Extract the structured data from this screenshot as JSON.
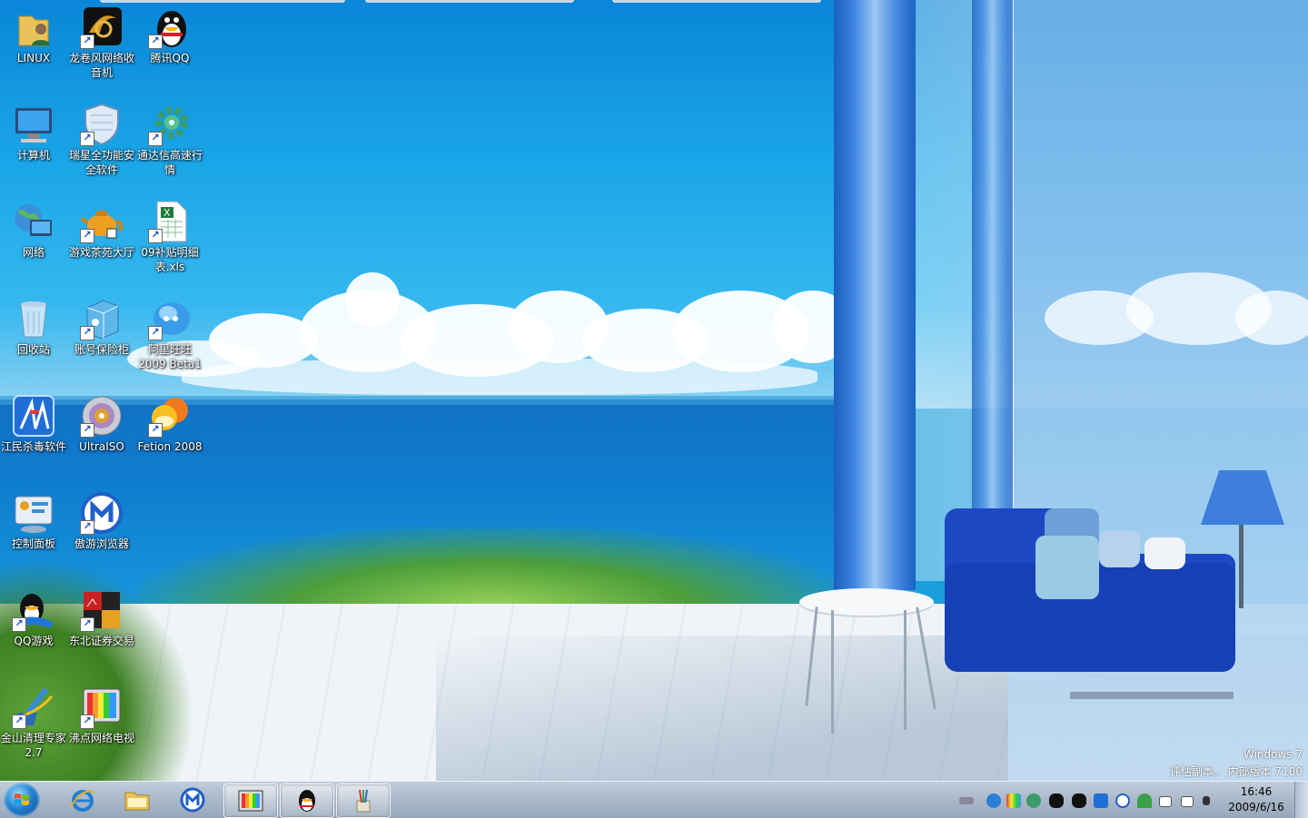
{
  "desktop": {
    "icons": [
      {
        "label": "LINUX",
        "icon": "folder-user-icon"
      },
      {
        "label": "龙卷风网络收音机",
        "icon": "radio-app-icon"
      },
      {
        "label": "腾讯QQ",
        "icon": "qq-penguin-icon"
      },
      {
        "label": "计算机",
        "icon": "computer-icon"
      },
      {
        "label": "瑞星全功能安全软件",
        "icon": "rising-shield-icon"
      },
      {
        "label": "通达信高速行情",
        "icon": "gear-icon"
      },
      {
        "label": "网络",
        "icon": "network-globe-icon"
      },
      {
        "label": "游戏茶苑大厅",
        "icon": "teapot-icon"
      },
      {
        "label": "09补贴明细表.xls",
        "icon": "excel-file-icon"
      },
      {
        "label": "回收站",
        "icon": "recycle-bin-icon"
      },
      {
        "label": "账号保险柜",
        "icon": "safe-box-icon"
      },
      {
        "label": "阿里旺旺2009 Beta1",
        "icon": "aliwangwang-icon"
      },
      {
        "label": "江民杀毒软件",
        "icon": "jiangmin-antivirus-icon"
      },
      {
        "label": "UltraISO",
        "icon": "disc-icon"
      },
      {
        "label": "Fetion 2008",
        "icon": "fetion-icon"
      },
      {
        "label": "控制面板",
        "icon": "control-panel-icon"
      },
      {
        "label": "傲游浏览器",
        "icon": "maxthon-icon"
      },
      {
        "label": "QQ游戏",
        "icon": "qq-game-icon"
      },
      {
        "label": "东北证券交易",
        "icon": "stock-trade-icon"
      },
      {
        "label": "金山清理专家 2.7",
        "icon": "broom-cleaner-icon"
      },
      {
        "label": "沸点网络电视",
        "icon": "tv-icon"
      }
    ]
  },
  "watermark": {
    "line1": "Windows 7",
    "line2": "评估副本。 内部版本 7100"
  },
  "taskbar": {
    "pinned": [
      {
        "name": "ie-browser",
        "icon": "ie-icon"
      },
      {
        "name": "explorer",
        "icon": "folder-icon"
      },
      {
        "name": "maxthon",
        "icon": "maxthon-icon"
      },
      {
        "name": "tv",
        "icon": "tv-icon"
      },
      {
        "name": "qq",
        "icon": "qq-penguin-icon"
      },
      {
        "name": "paint",
        "icon": "paint-brushes-icon"
      }
    ],
    "clock": {
      "time": "16:46",
      "date": "2009/6/16"
    }
  },
  "colors": {
    "taskbar": "#aab8c9",
    "sky": "#1aa6e8",
    "sofa": "#1640b5"
  }
}
